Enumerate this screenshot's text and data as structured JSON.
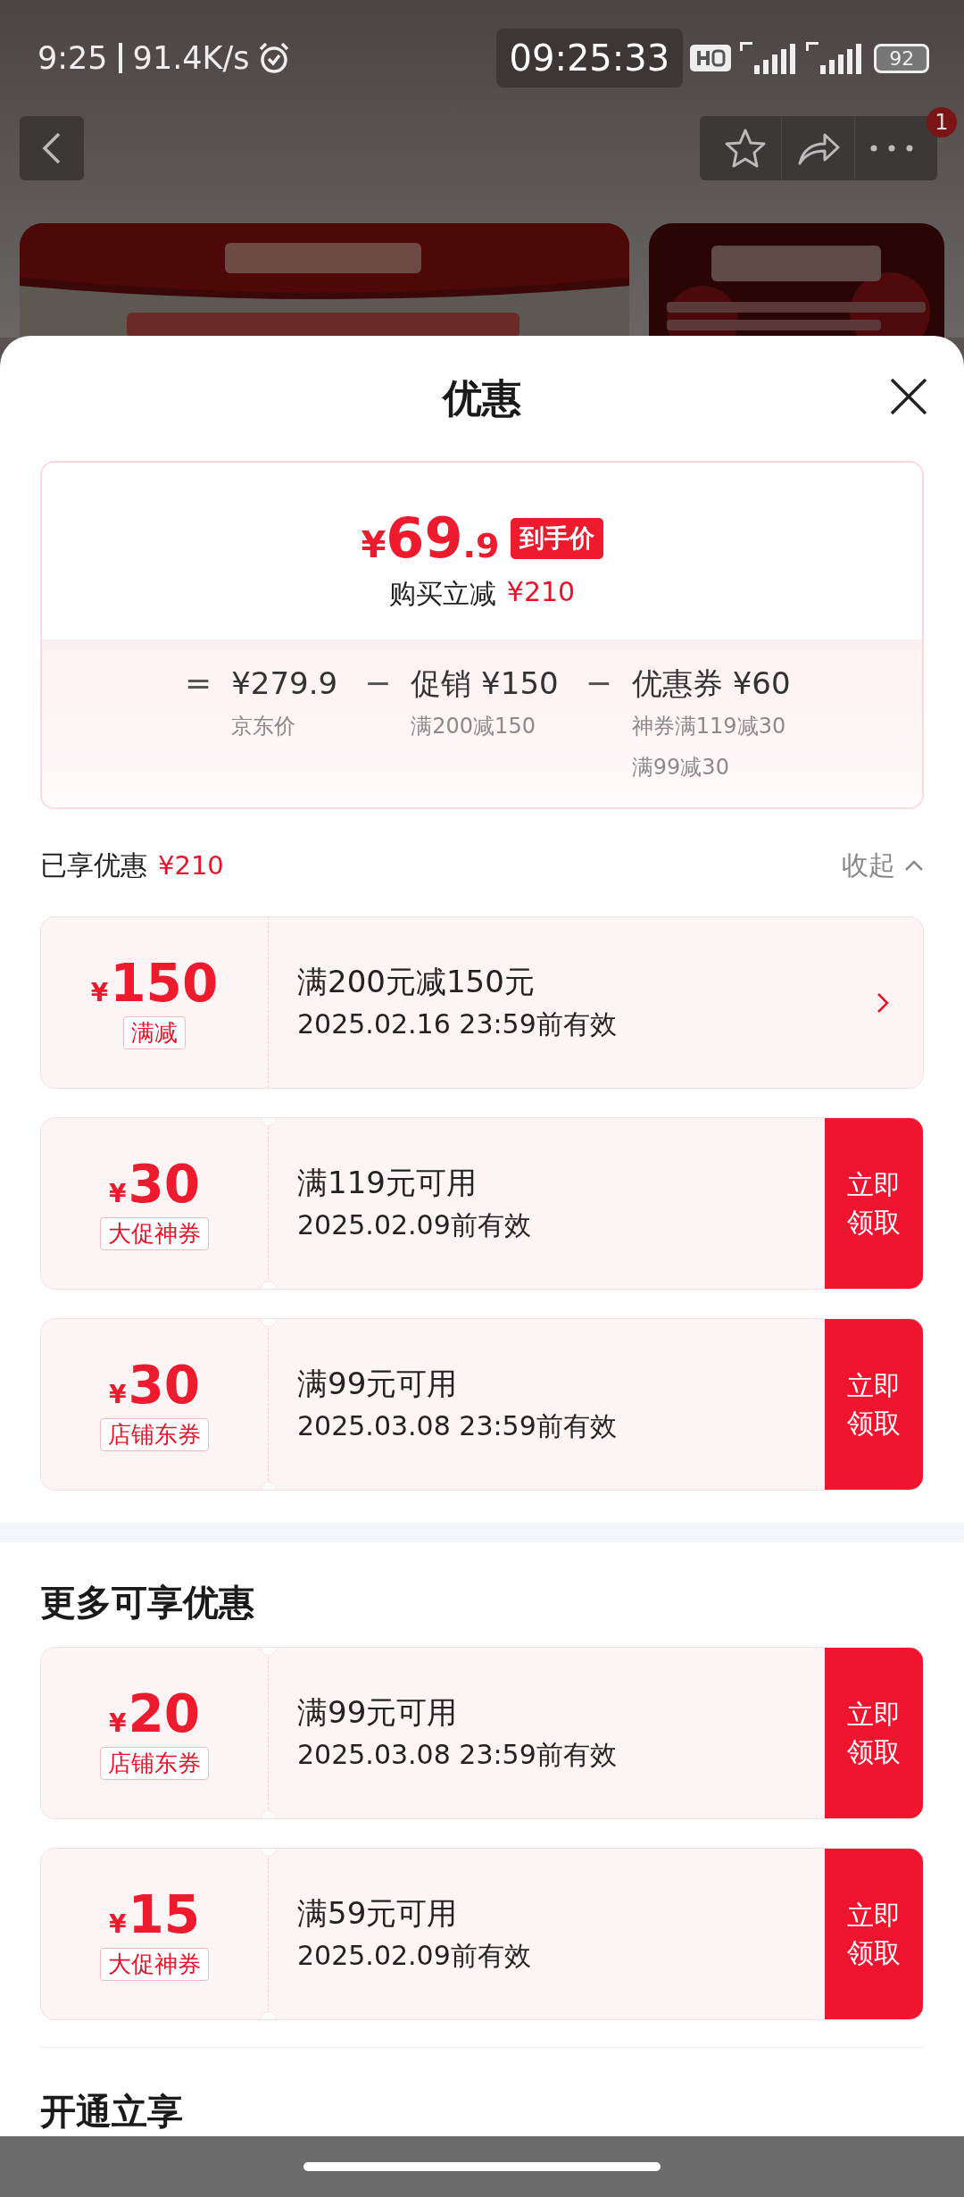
{
  "status_bar": {
    "time": "9:25",
    "speed": "91.4K/s",
    "clock": "09:25:33",
    "battery": "92"
  },
  "nav": {
    "badge": "1"
  },
  "sheet": {
    "title": "优惠"
  },
  "price_card": {
    "currency": "¥",
    "price_integer": "69",
    "price_decimal": ".9",
    "badge": "到手价",
    "saving_label": "购买立减",
    "saving": "¥210",
    "breakdown": [
      {
        "operator": "=",
        "amount": "¥279.9",
        "notes": [
          "京东价"
        ]
      },
      {
        "operator": "−",
        "amount": "促销 ¥150",
        "notes": [
          "满200减150"
        ]
      },
      {
        "operator": "−",
        "amount": "优惠券 ¥60",
        "notes": [
          "神券满119减30",
          "满99减30"
        ]
      }
    ]
  },
  "applied": {
    "label": "已享优惠",
    "amount": "¥210",
    "toggle": "收起",
    "expanded": true,
    "coupons": [
      {
        "kind": "promotion",
        "currency": "¥",
        "amount": "150",
        "tag": "满减",
        "title": "满200元减150元",
        "validity": "2025.02.16 23:59前有效"
      },
      {
        "kind": "claim",
        "currency": "¥",
        "amount": "30",
        "tag": "大促神券",
        "title": "满119元可用",
        "validity": "2025.02.09前有效",
        "action": "立即领取"
      },
      {
        "kind": "claim",
        "currency": "¥",
        "amount": "30",
        "tag": "店铺东券",
        "title": "满99元可用",
        "validity": "2025.03.08 23:59前有效",
        "action": "立即领取"
      }
    ]
  },
  "more": {
    "title": "更多可享优惠",
    "coupons": [
      {
        "kind": "claim",
        "currency": "¥",
        "amount": "20",
        "tag": "店铺东券",
        "title": "满99元可用",
        "validity": "2025.03.08 23:59前有效",
        "action": "立即领取"
      },
      {
        "kind": "claim",
        "currency": "¥",
        "amount": "15",
        "tag": "大促神券",
        "title": "满59元可用",
        "validity": "2025.02.09前有效",
        "action": "立即领取"
      }
    ]
  },
  "footer_title": "开通立享"
}
